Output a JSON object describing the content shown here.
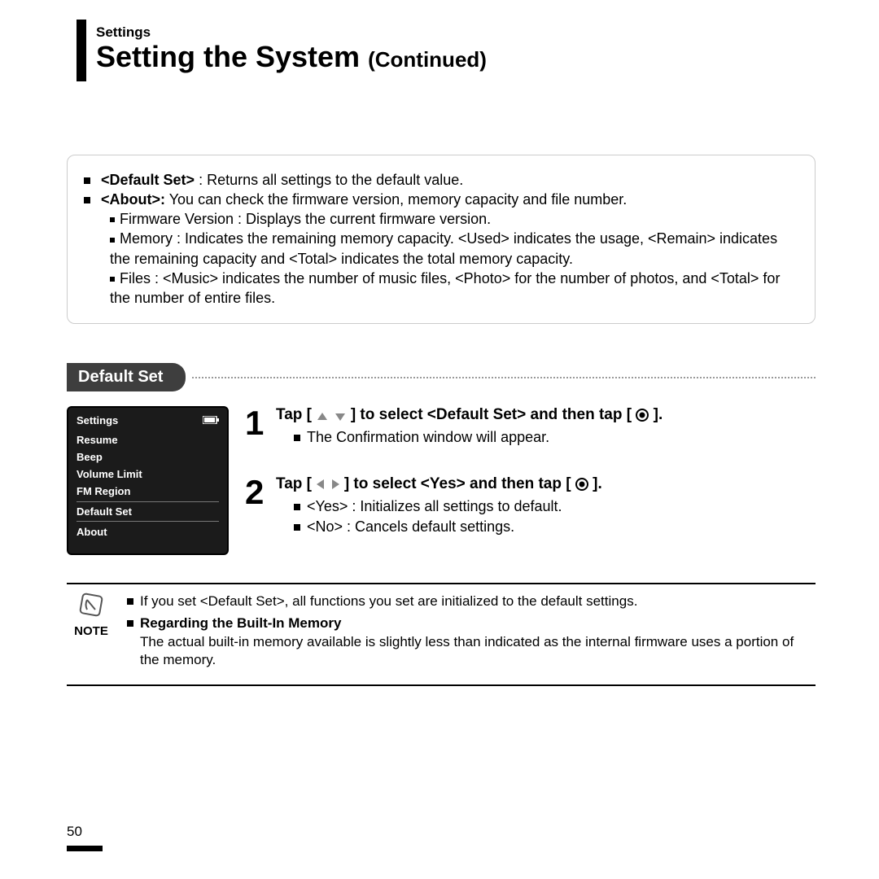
{
  "header": {
    "section_label": "Settings",
    "title_main": "Setting the System",
    "title_cont": "(Continued)"
  },
  "info": {
    "default_set_label": "<Default Set>",
    "default_set_text": " : Returns all settings to the default value.",
    "about_label": "<About>:",
    "about_text": " You can check the firmware version, memory capacity and file number.",
    "sub_fw": "Firmware Version : Displays the current firmware version.",
    "sub_mem": "Memory : Indicates the remaining memory capacity. <Used> indicates the usage, <Remain> indicates the remaining capacity and <Total> indicates the total memory capacity.",
    "sub_files": "Files : <Music> indicates the number of music files, <Photo> for the number of photos, and <Total> for the number of entire files."
  },
  "section_heading": "Default Set",
  "device": {
    "title": "Settings",
    "items": [
      "Resume",
      "Beep",
      "Volume Limit",
      "FM Region",
      "Default Set",
      "About"
    ],
    "selected_index": 4
  },
  "steps": {
    "s1": {
      "num": "1",
      "title_pre": "Tap [",
      "title_post": "] to select <Default Set> and then tap [",
      "title_end": "].",
      "sub": "The Confirmation window will appear."
    },
    "s2": {
      "num": "2",
      "title_pre": "Tap [",
      "title_post": "] to select <Yes> and then tap [",
      "title_end": "].",
      "yes": "<Yes> :  Initializes all settings to default.",
      "no": "<No> : Cancels default settings."
    }
  },
  "note": {
    "label": "NOTE",
    "line1": "If you set <Default Set>, all functions you set are initialized to the default settings.",
    "line2_label": "Regarding the Built-In Memory",
    "line2_text": "The actual built-in memory available is slightly less than indicated as the internal firmware uses a portion of the memory."
  },
  "page_number": "50"
}
